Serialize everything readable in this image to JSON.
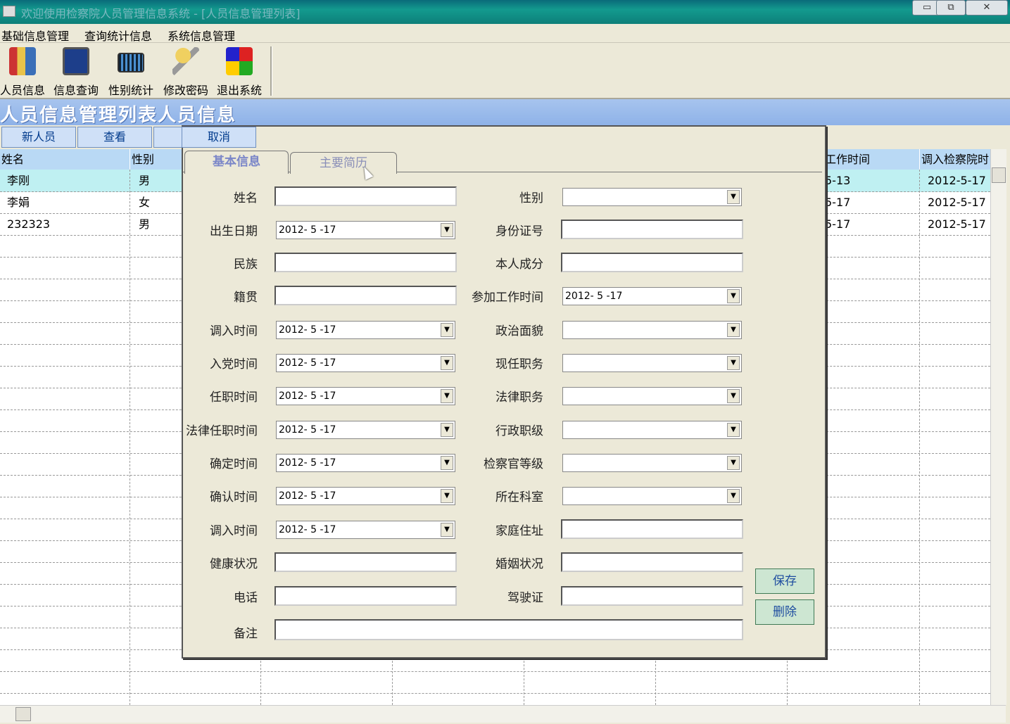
{
  "window": {
    "title": "欢迎使用检察院人员管理信息系统 - [人员信息管理列表]",
    "minimize": "▭",
    "restore": "⧉",
    "close": "✕"
  },
  "menu": [
    "基础信息管理",
    "查询统计信息",
    "系统信息管理"
  ],
  "toolbar": [
    {
      "label": "人员信息",
      "icon": "people-icon"
    },
    {
      "label": "信息查询",
      "icon": "sql-query-icon"
    },
    {
      "label": "性别统计",
      "icon": "calculator-icon"
    },
    {
      "label": "修改密码",
      "icon": "keys-icon"
    },
    {
      "label": "退出系统",
      "icon": "exit-windows-icon"
    }
  ],
  "header_title": "人员信息管理列表人员信息",
  "actions": {
    "new": "新人员",
    "view": "查看"
  },
  "grid": {
    "columns": [
      "姓名",
      "性别",
      "工作时间",
      "调入检察院时"
    ],
    "rows": [
      {
        "name": "李刚",
        "gender": "男",
        "work": "5-13",
        "join": "2012-5-17"
      },
      {
        "name": "李娟",
        "gender": "女",
        "work": "5-17",
        "join": "2012-5-17"
      },
      {
        "name": "232323",
        "gender": "男",
        "work": "5-17",
        "join": "2012-5-17"
      }
    ]
  },
  "dialog": {
    "cancel": "取消",
    "tabs": [
      "基本信息",
      "主要简历"
    ],
    "save": "保存",
    "delete": "删除",
    "left_fields": [
      {
        "label": "姓名",
        "type": "text",
        "value": ""
      },
      {
        "label": "出生日期",
        "type": "date",
        "value": "2012- 5 -17"
      },
      {
        "label": "民族",
        "type": "text",
        "value": ""
      },
      {
        "label": "籍贯",
        "type": "text",
        "value": ""
      },
      {
        "label": "调入时间",
        "type": "date",
        "value": "2012- 5 -17"
      },
      {
        "label": "入党时间",
        "type": "date",
        "value": "2012- 5 -17"
      },
      {
        "label": "任职时间",
        "type": "date",
        "value": "2012- 5 -17"
      },
      {
        "label": "法律任职时间",
        "type": "date",
        "value": "2012- 5 -17"
      },
      {
        "label": "确定时间",
        "type": "date",
        "value": "2012- 5 -17"
      },
      {
        "label": "确认时间",
        "type": "date",
        "value": "2012- 5 -17"
      },
      {
        "label": "调入时间",
        "type": "date",
        "value": "2012- 5 -17"
      },
      {
        "label": "健康状况",
        "type": "text",
        "value": ""
      },
      {
        "label": "电话",
        "type": "text",
        "value": ""
      }
    ],
    "right_fields": [
      {
        "label": "性别",
        "type": "combo",
        "value": ""
      },
      {
        "label": "身份证号",
        "type": "text",
        "value": ""
      },
      {
        "label": "本人成分",
        "type": "text",
        "value": ""
      },
      {
        "label": "参加工作时间",
        "type": "date",
        "value": "2012- 5 -17"
      },
      {
        "label": "政治面貌",
        "type": "combo",
        "value": ""
      },
      {
        "label": "现任职务",
        "type": "combo",
        "value": ""
      },
      {
        "label": "法律职务",
        "type": "combo",
        "value": ""
      },
      {
        "label": "行政职级",
        "type": "combo",
        "value": ""
      },
      {
        "label": "检察官等级",
        "type": "combo",
        "value": ""
      },
      {
        "label": "所在科室",
        "type": "combo",
        "value": ""
      },
      {
        "label": "家庭住址",
        "type": "text",
        "value": ""
      },
      {
        "label": "婚姻状况",
        "type": "text",
        "value": ""
      },
      {
        "label": "驾驶证",
        "type": "text",
        "value": ""
      }
    ],
    "remark_label": "备注"
  }
}
